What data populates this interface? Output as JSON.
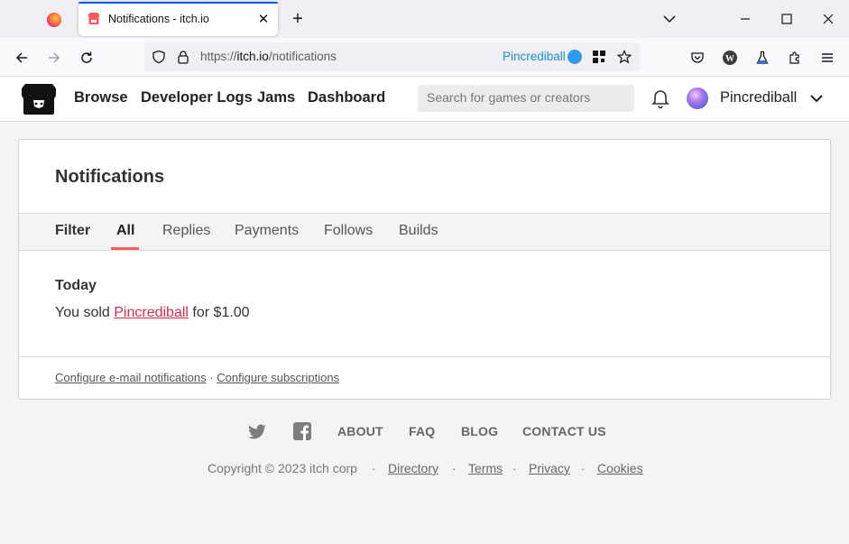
{
  "browser": {
    "tab_title": "Notifications - itch.io",
    "url_prefix": "https://",
    "url_host": "itch.io",
    "url_path": "/notifications",
    "url_chip": "Pincrediball"
  },
  "site": {
    "nav": [
      "Browse",
      "Developer Logs",
      "Jams",
      "Dashboard"
    ],
    "search_placeholder": "Search for games or creators",
    "username": "Pincrediball"
  },
  "page": {
    "title": "Notifications",
    "filter_label": "Filter",
    "filters": [
      "All",
      "Replies",
      "Payments",
      "Follows",
      "Builds"
    ],
    "active_filter": "All",
    "day_header": "Today",
    "notification": {
      "prefix": "You sold",
      "link": "Pincrediball",
      "suffix": "for $1.00"
    },
    "config_email": "Configure e-mail notifications",
    "config_sep": "·",
    "config_subscriptions": "Configure subscriptions"
  },
  "footer": {
    "links": [
      "ABOUT",
      "FAQ",
      "BLOG",
      "CONTACT US"
    ],
    "copyright": "Copyright © 2023 itch corp",
    "sep": "·",
    "legal_links": [
      "Directory",
      "Terms",
      "Privacy",
      "Cookies"
    ]
  },
  "colors": {
    "accent": "#fa5c5c",
    "link": "#da2c49",
    "firefox_blue": "#0060df"
  }
}
